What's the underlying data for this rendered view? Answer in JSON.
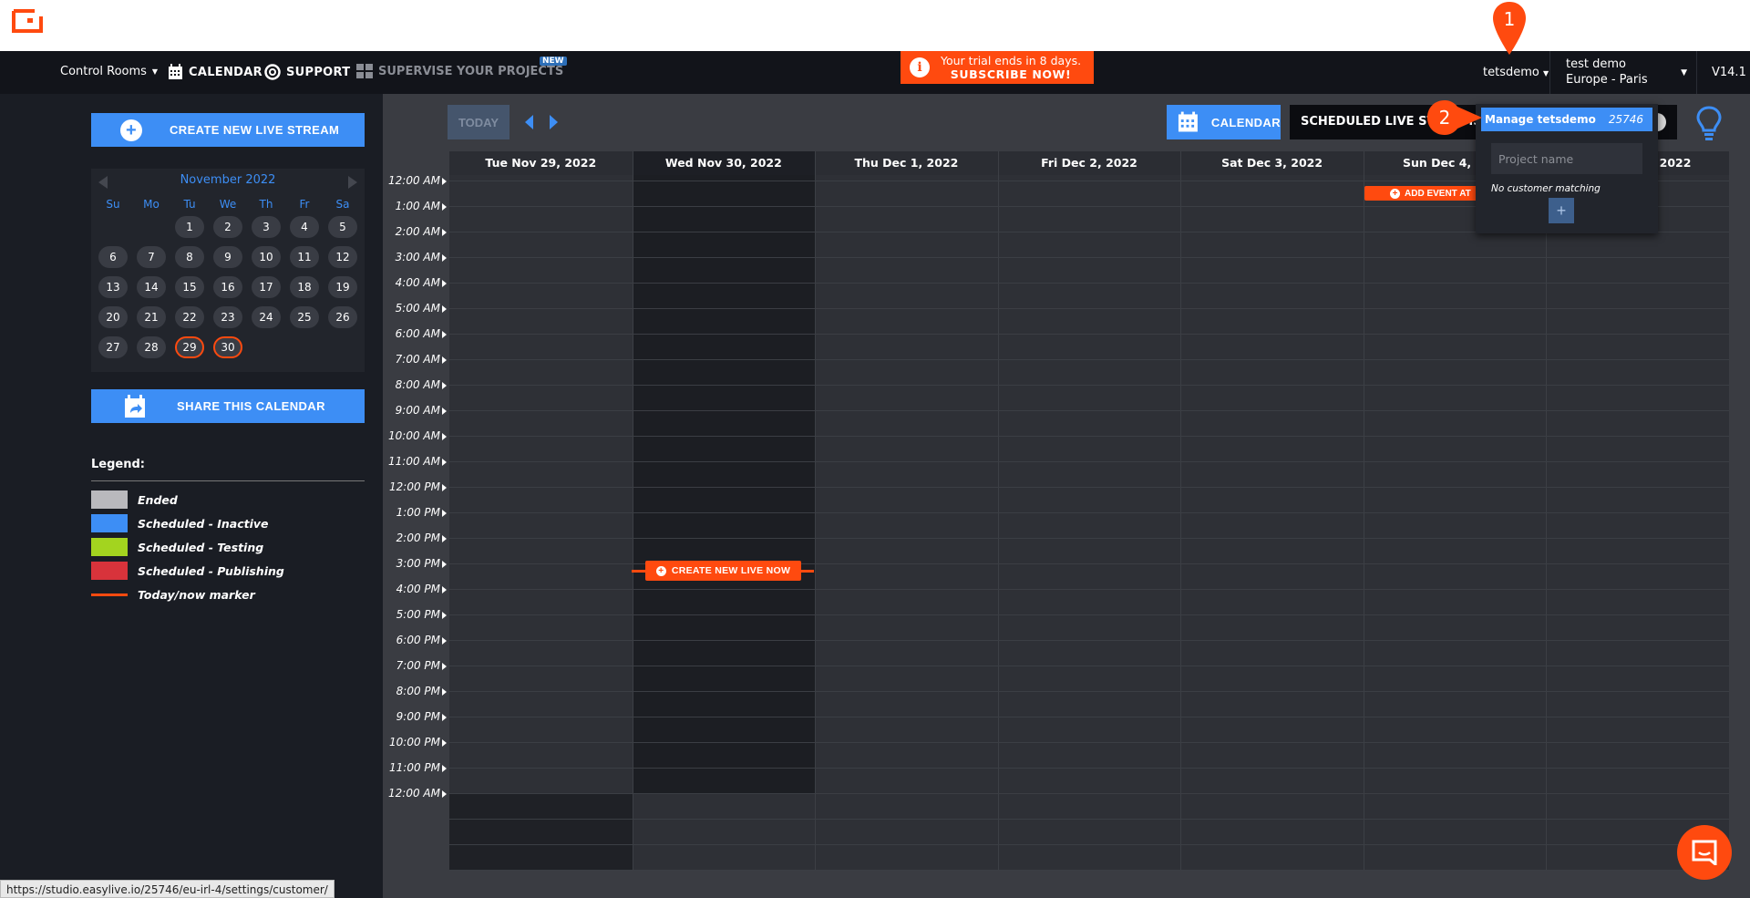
{
  "topnav": {
    "control_rooms": "Control Rooms",
    "calendar": "CALENDAR",
    "support": "SUPPORT",
    "supervise": "SUPERVISE YOUR PROJECTS",
    "new_badge": "NEW",
    "trial_line1": "Your trial ends in 8 days.",
    "trial_line2": "SUBSCRIBE NOW!",
    "user": "tetsdemo",
    "account_name": "test demo",
    "account_region": "Europe - Paris",
    "version": "V14.1"
  },
  "sidebar": {
    "create_button": "CREATE NEW LIVE STREAM",
    "share_button": "SHARE THIS CALENDAR",
    "minical": {
      "month": "November 2022",
      "weekdays": [
        "Su",
        "Mo",
        "Tu",
        "We",
        "Th",
        "Fr",
        "Sa"
      ],
      "weeks": [
        [
          "",
          "",
          "1",
          "2",
          "3",
          "4",
          "5"
        ],
        [
          "6",
          "7",
          "8",
          "9",
          "10",
          "11",
          "12"
        ],
        [
          "13",
          "14",
          "15",
          "16",
          "17",
          "18",
          "19"
        ],
        [
          "20",
          "21",
          "22",
          "23",
          "24",
          "25",
          "26"
        ],
        [
          "27",
          "28",
          "29",
          "30",
          "",
          "",
          ""
        ]
      ],
      "highlighted": [
        "29",
        "30"
      ]
    },
    "legend": {
      "title": "Legend:",
      "items": [
        {
          "label": "Ended",
          "color": "#b9b9bd"
        },
        {
          "label": "Scheduled - Inactive",
          "color": "#3d8ef5"
        },
        {
          "label": "Scheduled - Testing",
          "color": "#a3d41f"
        },
        {
          "label": "Scheduled - Publishing",
          "color": "#d8333b"
        },
        {
          "label": "Today/now marker",
          "color": "#ff4a0f"
        }
      ]
    }
  },
  "toolbar": {
    "today": "TODAY",
    "calendar": "CALENDAR",
    "scheduled": "SCHEDULED LIVE STREAMS"
  },
  "calendar": {
    "days": [
      "Tue Nov 29, 2022",
      "Wed Nov 30, 2022",
      "Thu Dec 1, 2022",
      "Fri Dec 2, 2022",
      "Sat Dec 3, 2022",
      "Sun Dec 4, 2022",
      "Mon Dec 5, 2022"
    ],
    "current_day_index": 1,
    "times": [
      "12:00 AM",
      "1:00 AM",
      "2:00 AM",
      "3:00 AM",
      "4:00 AM",
      "5:00 AM",
      "6:00 AM",
      "7:00 AM",
      "8:00 AM",
      "9:00 AM",
      "10:00 AM",
      "11:00 AM",
      "12:00 PM",
      "1:00 PM",
      "2:00 PM",
      "3:00 PM",
      "4:00 PM",
      "5:00 PM",
      "6:00 PM",
      "7:00 PM",
      "8:00 PM",
      "9:00 PM",
      "10:00 PM",
      "11:00 PM",
      "12:00 AM"
    ],
    "create_live_now": "CREATE NEW LIVE NOW",
    "add_event": "ADD EVENT AT"
  },
  "dropdown": {
    "header": "Manage tetsdemo",
    "id": "25746",
    "placeholder": "Project name",
    "empty": "No customer matching",
    "plus": "+"
  },
  "annotations": {
    "marker1": "1",
    "marker2": "2"
  },
  "status_url": "https://studio.easylive.io/25746/eu-irl-4/settings/customer/",
  "colors": {
    "accent": "#3d8ef5",
    "brand": "#ff4a0f"
  }
}
